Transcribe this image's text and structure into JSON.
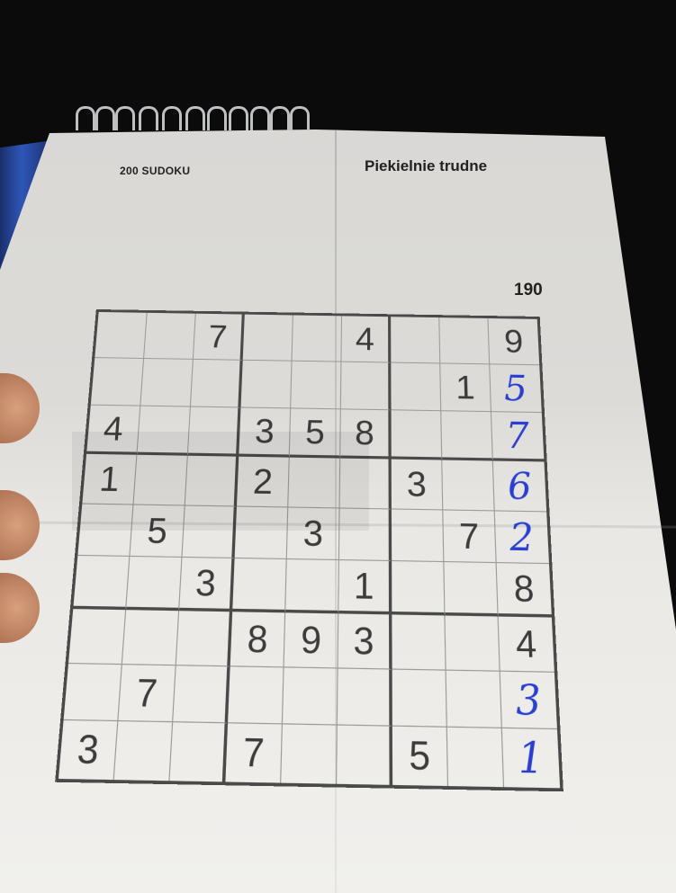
{
  "header": {
    "book_title": "200 SUDOKU",
    "difficulty": "Piekielnie trudne",
    "puzzle_number": "190"
  },
  "grid": {
    "rows": [
      [
        "",
        "",
        "7",
        "",
        "",
        "4",
        "",
        "",
        "9"
      ],
      [
        "",
        "",
        "",
        "",
        "",
        "",
        "",
        "1",
        "5"
      ],
      [
        "4",
        "",
        "",
        "3",
        "5",
        "8",
        "",
        "",
        "7"
      ],
      [
        "1",
        "",
        "",
        "2",
        "",
        "",
        "3",
        "",
        "6"
      ],
      [
        "",
        "5",
        "",
        "",
        "3",
        "",
        "",
        "7",
        "2"
      ],
      [
        "",
        "",
        "3",
        "",
        "",
        "1",
        "",
        "",
        "8"
      ],
      [
        "",
        "",
        "",
        "8",
        "9",
        "3",
        "",
        "",
        "4"
      ],
      [
        "",
        "7",
        "",
        "",
        "",
        "",
        "",
        "",
        "3"
      ],
      [
        "3",
        "",
        "",
        "7",
        "",
        "",
        "5",
        "",
        "1"
      ]
    ],
    "handwritten": [
      [
        false,
        false,
        false,
        false,
        false,
        false,
        false,
        false,
        false
      ],
      [
        false,
        false,
        false,
        false,
        false,
        false,
        false,
        false,
        true
      ],
      [
        false,
        false,
        false,
        false,
        false,
        false,
        false,
        false,
        true
      ],
      [
        false,
        false,
        false,
        false,
        false,
        false,
        false,
        false,
        true
      ],
      [
        false,
        false,
        false,
        false,
        false,
        false,
        false,
        false,
        true
      ],
      [
        false,
        false,
        false,
        false,
        false,
        false,
        false,
        false,
        false
      ],
      [
        false,
        false,
        false,
        false,
        false,
        false,
        false,
        false,
        false
      ],
      [
        false,
        false,
        false,
        false,
        false,
        false,
        false,
        false,
        true
      ],
      [
        false,
        false,
        false,
        false,
        false,
        false,
        false,
        false,
        true
      ]
    ],
    "handwriting_color": "#2a3fd0",
    "print_color": "#3b3b3b"
  }
}
